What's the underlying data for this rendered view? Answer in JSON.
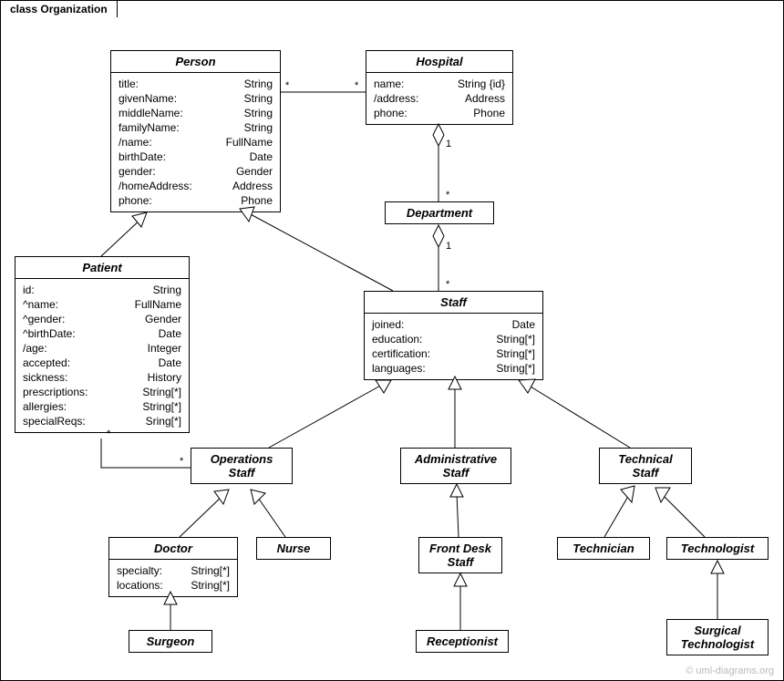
{
  "frame": {
    "title": "class Organization"
  },
  "watermark": "© uml-diagrams.org",
  "classes": {
    "person": {
      "name": "Person",
      "attrs": [
        {
          "k": "title:",
          "t": "String"
        },
        {
          "k": "givenName:",
          "t": "String"
        },
        {
          "k": "middleName:",
          "t": "String"
        },
        {
          "k": "familyName:",
          "t": "String"
        },
        {
          "k": "/name:",
          "t": "FullName"
        },
        {
          "k": "birthDate:",
          "t": "Date"
        },
        {
          "k": "gender:",
          "t": "Gender"
        },
        {
          "k": "/homeAddress:",
          "t": "Address"
        },
        {
          "k": "phone:",
          "t": "Phone"
        }
      ]
    },
    "hospital": {
      "name": "Hospital",
      "attrs": [
        {
          "k": "name:",
          "t": "String {id}"
        },
        {
          "k": "/address:",
          "t": "Address"
        },
        {
          "k": "phone:",
          "t": "Phone"
        }
      ]
    },
    "department": {
      "name": "Department"
    },
    "patient": {
      "name": "Patient",
      "attrs": [
        {
          "k": "id:",
          "t": "String"
        },
        {
          "k": "^name:",
          "t": "FullName"
        },
        {
          "k": "^gender:",
          "t": "Gender"
        },
        {
          "k": "^birthDate:",
          "t": "Date"
        },
        {
          "k": "/age:",
          "t": "Integer"
        },
        {
          "k": "accepted:",
          "t": "Date"
        },
        {
          "k": "sickness:",
          "t": "History"
        },
        {
          "k": "prescriptions:",
          "t": "String[*]"
        },
        {
          "k": "allergies:",
          "t": "String[*]"
        },
        {
          "k": "specialReqs:",
          "t": "Sring[*]"
        }
      ]
    },
    "staff": {
      "name": "Staff",
      "attrs": [
        {
          "k": "joined:",
          "t": "Date"
        },
        {
          "k": "education:",
          "t": "String[*]"
        },
        {
          "k": "certification:",
          "t": "String[*]"
        },
        {
          "k": "languages:",
          "t": "String[*]"
        }
      ]
    },
    "operations_staff": {
      "name": "Operations",
      "name2": "Staff"
    },
    "administrative_staff": {
      "name": "Administrative",
      "name2": "Staff"
    },
    "technical_staff": {
      "name": "Technical",
      "name2": "Staff"
    },
    "doctor": {
      "name": "Doctor",
      "attrs": [
        {
          "k": "specialty:",
          "t": "String[*]"
        },
        {
          "k": "locations:",
          "t": "String[*]"
        }
      ]
    },
    "nurse": {
      "name": "Nurse"
    },
    "front_desk_staff": {
      "name": "Front Desk",
      "name2": "Staff"
    },
    "receptionist": {
      "name": "Receptionist"
    },
    "technician": {
      "name": "Technician"
    },
    "technologist": {
      "name": "Technologist"
    },
    "surgeon": {
      "name": "Surgeon"
    },
    "surgical_technologist": {
      "name": "Surgical",
      "name2": "Technologist"
    }
  },
  "mult": {
    "star": "*",
    "one": "1"
  }
}
